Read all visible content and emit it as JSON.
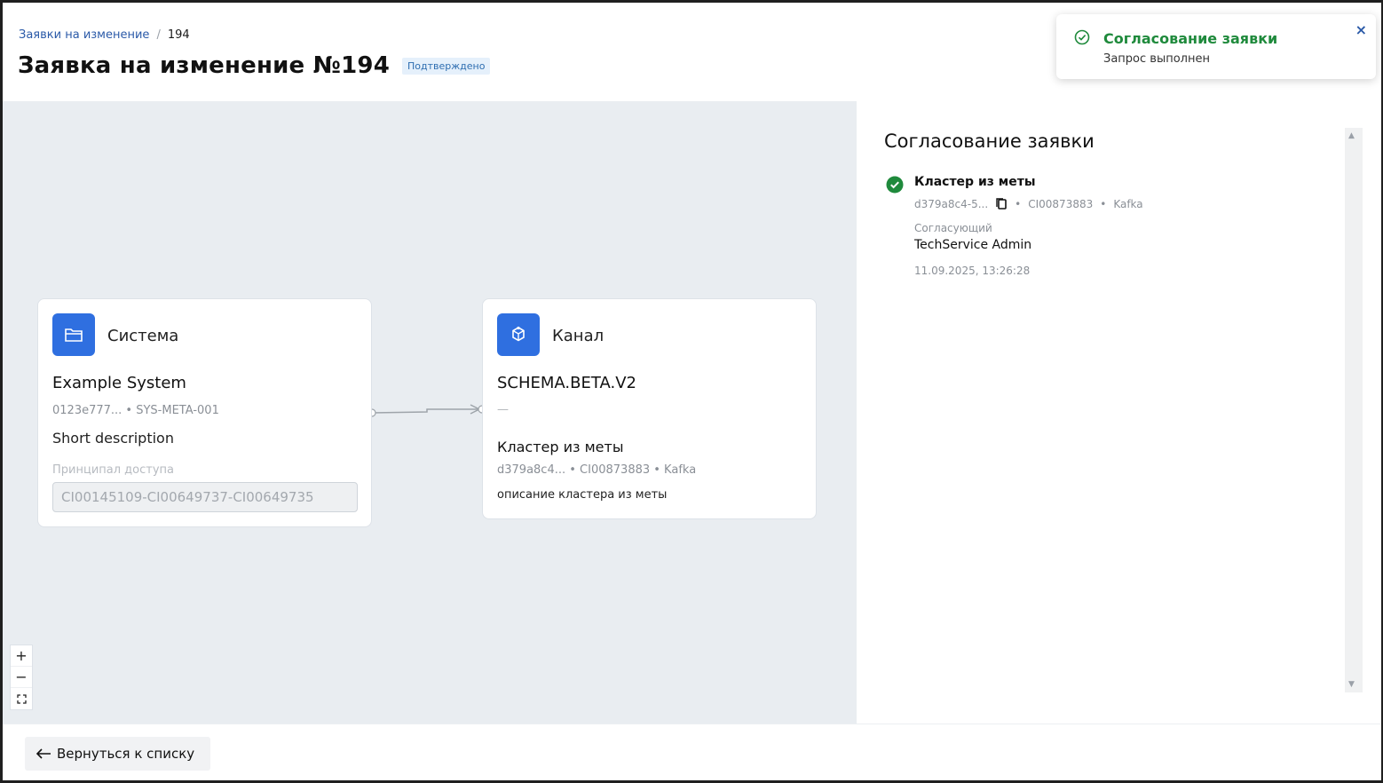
{
  "breadcrumb": {
    "parent": "Заявки на изменение",
    "separator": "/",
    "current": "194"
  },
  "page": {
    "title": "Заявка на изменение №194",
    "status": "Подтверждено"
  },
  "toast": {
    "title": "Согласование заявки",
    "message": "Запрос выполнен",
    "close": "×",
    "icon": "check-circle-icon"
  },
  "nodes": {
    "system": {
      "type": "Система",
      "icon": "folder-icon",
      "name": "Example System",
      "meta": "0123e777... • SYS-META-001",
      "description": "Short description",
      "principal_label": "Принципал доступа",
      "principal_value": "CI00145109-CI00649737-CI00649735"
    },
    "channel": {
      "type": "Канал",
      "icon": "cube-icon",
      "name": "SCHEMA.BETA.V2",
      "dash": "—",
      "cluster_name": "Кластер из меты",
      "cluster_meta": "d379a8c4... • CI00873883 • Kafka",
      "cluster_description": "описание кластера из меты"
    }
  },
  "zoom": {
    "in": "+",
    "out": "−",
    "fit": "⛶"
  },
  "panel": {
    "title": "Согласование заявки",
    "approval": {
      "name": "Кластер из меты",
      "id_short": "d379a8c4-5...",
      "ci": "CI00873883",
      "kind": "Kafka",
      "dot": "•",
      "approver_label": "Согласующий",
      "approver": "TechService Admin",
      "date": "11.09.2025, 13:26:28"
    }
  },
  "footer": {
    "back_label": "Вернуться к списку"
  },
  "colors": {
    "accent": "#2f6fe0",
    "success": "#1f8a3c",
    "link": "#2b5aa8",
    "canvas_bg": "#e9edf1"
  }
}
